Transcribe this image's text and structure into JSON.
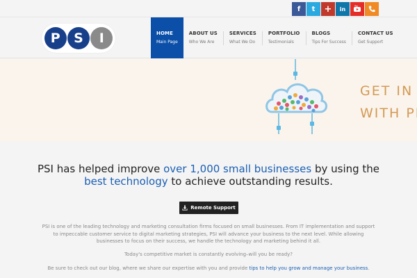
{
  "social": {
    "items": [
      {
        "icon": "facebook-icon",
        "glyph": "f",
        "color": "#3b5998"
      },
      {
        "icon": "twitter-icon",
        "glyph": "t",
        "color": "#29a9df"
      },
      {
        "icon": "google-plus-icon",
        "glyph": "+",
        "color": "#c0392b"
      },
      {
        "icon": "linkedin-icon",
        "glyph": "in",
        "color": "#0e76a8"
      },
      {
        "icon": "youtube-icon",
        "glyph": "",
        "color": "#e52d27"
      },
      {
        "icon": "phone-icon",
        "glyph": "",
        "color": "#f08a24"
      }
    ]
  },
  "logo": {
    "letters": [
      "P",
      "S",
      "I"
    ],
    "colors": [
      "#173f8a",
      "#173f8a",
      "#8a8a8a"
    ]
  },
  "nav": {
    "items": [
      {
        "label": "HOME",
        "sub": "Main Page"
      },
      {
        "label": "ABOUT US",
        "sub": "Who We Are"
      },
      {
        "label": "SERVICES",
        "sub": "What We Do"
      },
      {
        "label": "PORTFOLIO",
        "sub": "Testimonials"
      },
      {
        "label": "BLOGS",
        "sub": "Tips For Success"
      },
      {
        "label": "CONTACT US",
        "sub": "Get Support"
      }
    ],
    "active_index": 0,
    "active_color": "#0b4fa8"
  },
  "banner": {
    "line1": "GET IN T",
    "line2": "WITH PR",
    "title_color": "#d39a55"
  },
  "headline": {
    "part1": "PSI has helped improve ",
    "highlight1": "over 1,000 small businesses",
    "part2": " by using the ",
    "highlight2": "best technology",
    "part3": " to achieve outstanding results."
  },
  "remote_button": {
    "label": "Remote Support",
    "icon": "download-icon"
  },
  "paragraphs": {
    "p1": "PSI is one of the leading technology and marketing consultation firms focused on small businesses. From IT implementation and support to impeccable customer service to digital marketing strategies, PSI will advance your business to the next level. While allowing businesses to focus on their success, we handle the technology and marketing behind it all.",
    "p2": "Today's competitive market is constantly evolving–will you be ready?",
    "p3_text": "Be sure to check out our blog, where we share our expertise with you and provide ",
    "p3_link": "tips to help you grow and manage your business",
    "p3_end": "."
  },
  "colors": {
    "accent": "#1a5fb4",
    "banner_bg": "#fbf4ec",
    "page_bg": "#f4f4f4"
  }
}
